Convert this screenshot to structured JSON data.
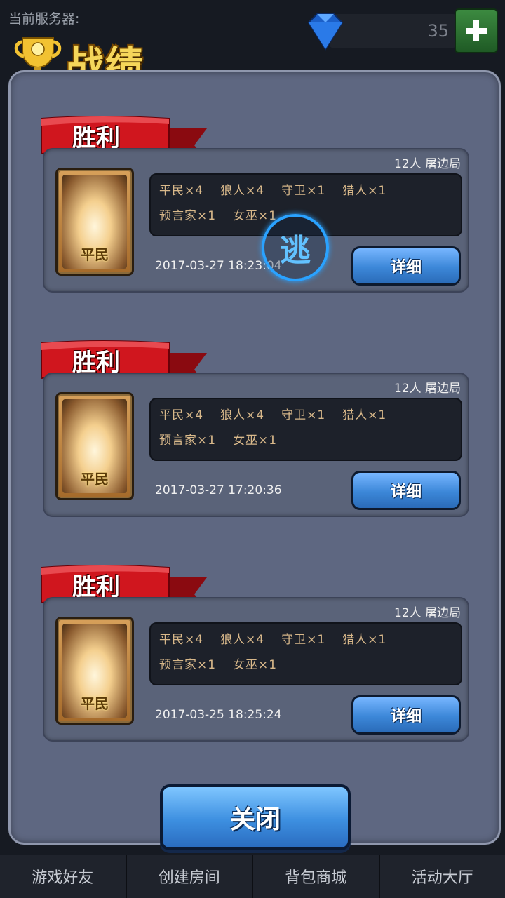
{
  "header": {
    "server_label": "当前服务器:",
    "title": "战绩",
    "gem_count": "35"
  },
  "records": [
    {
      "result": "胜利",
      "meta": "12人  屠边局",
      "role": "平民",
      "roles_line1": [
        "平民×4",
        "狼人×4",
        "守卫×1",
        "猎人×1"
      ],
      "roles_line2": [
        "预言家×1",
        "女巫×1"
      ],
      "time": "2017-03-27 18:23:04",
      "detail_label": "详细",
      "escape_badge": "逃"
    },
    {
      "result": "胜利",
      "meta": "12人  屠边局",
      "role": "平民",
      "roles_line1": [
        "平民×4",
        "狼人×4",
        "守卫×1",
        "猎人×1"
      ],
      "roles_line2": [
        "预言家×1",
        "女巫×1"
      ],
      "time": "2017-03-27 17:20:36",
      "detail_label": "详细"
    },
    {
      "result": "胜利",
      "meta": "12人  屠边局",
      "role": "平民",
      "roles_line1": [
        "平民×4",
        "狼人×4",
        "守卫×1",
        "猎人×1"
      ],
      "roles_line2": [
        "预言家×1",
        "女巫×1"
      ],
      "time": "2017-03-25 18:25:24",
      "detail_label": "详细"
    }
  ],
  "close_label": "关闭",
  "nav": [
    "游戏好友",
    "创建房间",
    "背包商城",
    "活动大厅"
  ],
  "colors": {
    "panel": "#5e6781",
    "ribbon": "#c8141c",
    "button_blue": "#3c87d8",
    "gold": "#f5d65a"
  }
}
